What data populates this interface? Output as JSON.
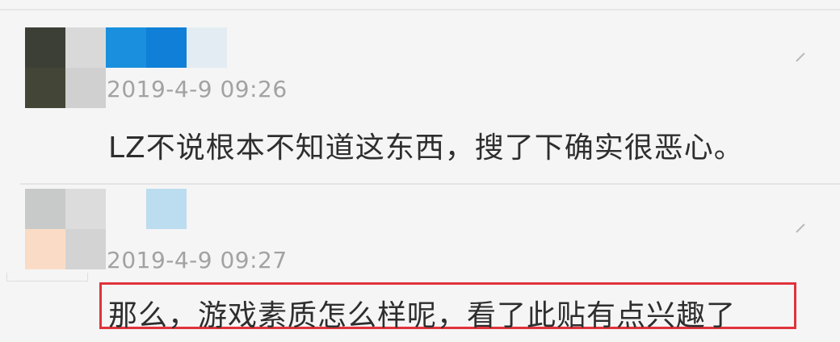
{
  "comments": [
    {
      "timestamp": "2019-4-9 09:26",
      "content": "LZ不说根本不知道这东西，搜了下确实很恶心。",
      "more_icon": "chevron-icon",
      "avatar_colors": [
        "#3c3f36",
        "#d9d9d9",
        "#434636",
        "#d0d0d0"
      ],
      "username_colors": [
        "#1a8fdd",
        "#0f7fd8",
        "#e3ecf2"
      ]
    },
    {
      "timestamp": "2019-4-9 09:27",
      "content": "那么，游戏素质怎么样呢，看了此贴有点兴趣了",
      "more_icon": "chevron-icon",
      "avatar_colors": [
        "#c8c9c9",
        "#dcdcdc",
        "#fadcc6",
        "#d3d3d3"
      ],
      "username_colors": [
        "#f5f5f5",
        "#bcdcef",
        "#f5f5f5"
      ]
    }
  ],
  "highlight_color": "#e0333b"
}
